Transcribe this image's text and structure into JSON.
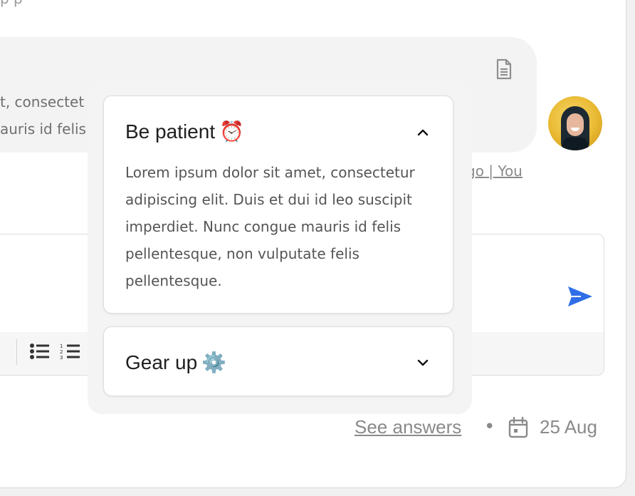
{
  "top_line": "p p",
  "bubble": {
    "line1": "t, consectet",
    "line2": "auris id felis",
    "doc_icon": "document-icon"
  },
  "meta_link": "go | You",
  "popover": {
    "items": [
      {
        "title": "Be patient",
        "emoji": "⏰",
        "expanded": true,
        "chevron": "chevron-up-icon",
        "body": "Lorem ipsum dolor sit amet, consectetur adipiscing elit. Duis et dui id leo suscipit imperdiet. Nunc congue mauris id felis pellentesque, non vulputate felis pellentesque."
      },
      {
        "title": "Gear up",
        "emoji": "⚙️",
        "expanded": false,
        "chevron": "chevron-down-icon"
      }
    ]
  },
  "composer": {
    "send_icon": "send-icon",
    "toolbar_icons": [
      "bullet-list-icon",
      "numbered-list-icon"
    ]
  },
  "footer": {
    "see_answers": "See answers",
    "separator": "•",
    "calendar_icon": "calendar-icon",
    "date": "25 Aug"
  },
  "colors": {
    "accent_send": "#2f6ee8",
    "text_muted": "#8a8a8a",
    "popover_bg": "#f4f4f4"
  }
}
